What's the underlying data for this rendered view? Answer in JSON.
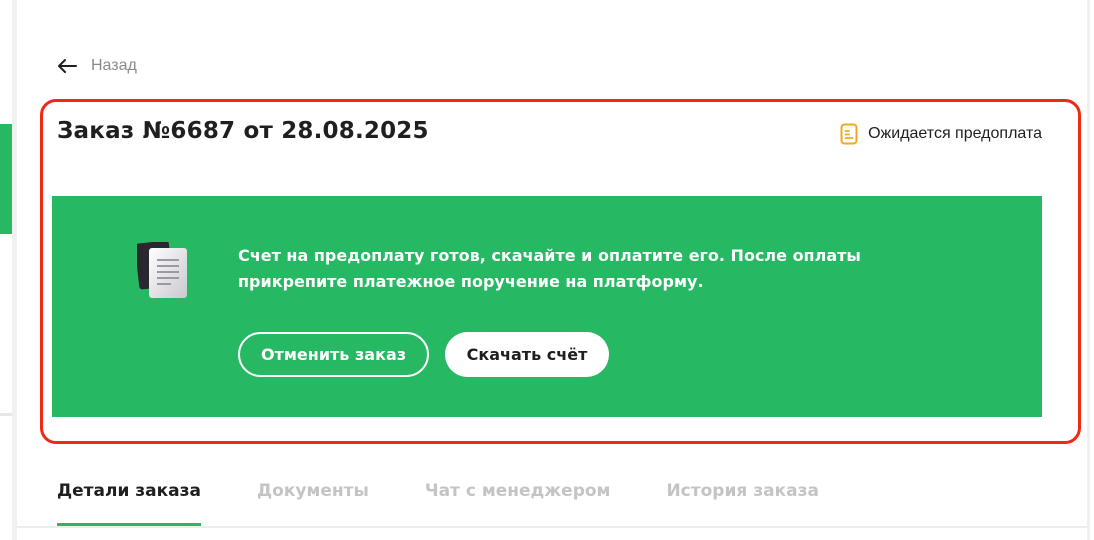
{
  "back": {
    "label": "Назад"
  },
  "order": {
    "title": "Заказ №6687 от 28.08.2025",
    "status": "Ожидается предоплата"
  },
  "banner": {
    "message": "Счет на предоплату готов, скачайте и оплатите его. После оплаты прикрепите платежное поручение на платформу.",
    "cancel_label": "Отменить заказ",
    "download_label": "Скачать счёт"
  },
  "tabs": [
    {
      "label": "Детали заказа",
      "active": true
    },
    {
      "label": "Документы",
      "active": false
    },
    {
      "label": "Чат с менеджером",
      "active": false
    },
    {
      "label": "История заказа",
      "active": false
    }
  ],
  "colors": {
    "accent_green": "#26b862",
    "highlight_red": "#ee2a14",
    "status_icon": "#f0a91e"
  },
  "icons": {
    "back": "arrow-left-icon",
    "status": "document-pending-icon",
    "banner": "invoice-documents-icon"
  }
}
